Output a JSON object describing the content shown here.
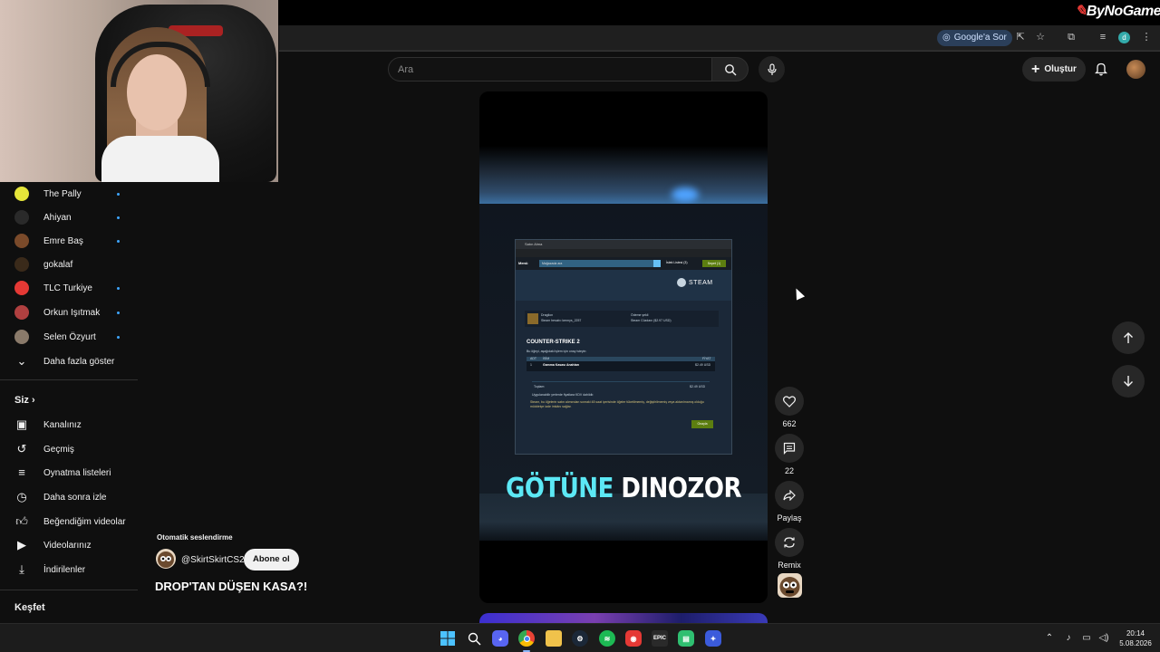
{
  "watermark": "ByNoGame",
  "browser": {
    "google_sor": "Google'a Sor",
    "profile_initial": "d"
  },
  "header": {
    "search_placeholder": "Ara",
    "create_label": "Oluştur"
  },
  "sidebar": {
    "subscriptions": [
      {
        "label": "The Pally",
        "color": "#e5e53a",
        "live": true
      },
      {
        "label": "Ahiyan",
        "color": "#222222",
        "live": true
      },
      {
        "label": "Emre Baş",
        "color": "#7a4a2a",
        "live": true
      },
      {
        "label": "gokalaf",
        "color": "#3a2a1a",
        "live": false
      },
      {
        "label": "TLC Turkiye",
        "color": "#e53935",
        "live": true
      },
      {
        "label": "Orkun Işıtmak",
        "color": "#b04040",
        "live": true
      },
      {
        "label": "Selen Özyurt",
        "color": "#8a7a6a",
        "live": true
      }
    ],
    "show_more": "Daha fazla göster",
    "you_heading": "Siz",
    "you_items": [
      {
        "label": "Kanalınız",
        "icon": "channel-icon"
      },
      {
        "label": "Geçmiş",
        "icon": "history-icon"
      },
      {
        "label": "Oynatma listeleri",
        "icon": "playlists-icon"
      },
      {
        "label": "Daha sonra izle",
        "icon": "watch-later-icon"
      },
      {
        "label": "Beğendiğim videolar",
        "icon": "thumbs-up-icon"
      },
      {
        "label": "Videolarınız",
        "icon": "your-videos-icon"
      },
      {
        "label": "İndirilenler",
        "icon": "download-icon"
      }
    ],
    "explore_heading": "Keşfet"
  },
  "short": {
    "caption_part1": "GÖTÜNE",
    "caption_part2": "DINOZOR",
    "steam": {
      "window_title": "Satın Alma",
      "menu": "Menü",
      "search_placeholder": "Mağazada ara",
      "wishlist": "İstek Listesi (3)",
      "cart": "Sepet (1)",
      "logo_text": "STEAM",
      "account_line1": "Dragilon",
      "account_line2": "Steam hesabı: kennys_2257",
      "payment_line1": "Ödeme şekli",
      "payment_line2": "Steam Cüzdanı ($2.97 USD)",
      "game_title": "COUNTER-STRIKE 2",
      "intro": "Bu öğeyi, aşağıdaki işlem için onay isteyin:",
      "table_qty_header": "ADT",
      "table_item_header": "İSİM",
      "table_price_header": "FİYAT",
      "row_qty": "1",
      "row_item": "Gamma Kasası Anahtarı",
      "row_price": "$2.49 USD",
      "total_label": "Toplam:",
      "total_value": "$2.49 USD",
      "tax_note": "Uygulanabilir yerlerde fiyatlara KDV dahildir.",
      "warning": "Steam, bu öğelerin satın alımından sonraki 48 saat içerisinde öğeler tüketilmemiş, değiştirilmemiş veya aktarılmamış olduğu müddetçe iade imkânı sağlar.",
      "accept_button": "Onayla"
    }
  },
  "actions": {
    "like_count": "662",
    "comment_count": "22",
    "share_label": "Paylaş",
    "remix_label": "Remix"
  },
  "channel": {
    "auto_dub": "Otomatik seslendirme",
    "handle": "@SkirtSkirtCS2",
    "subscribe_label": "Abone ol",
    "title": "DROP'TAN DÜŞEN KASA?!"
  },
  "taskbar": {
    "time": "20:14",
    "date": "5.08.2026"
  }
}
